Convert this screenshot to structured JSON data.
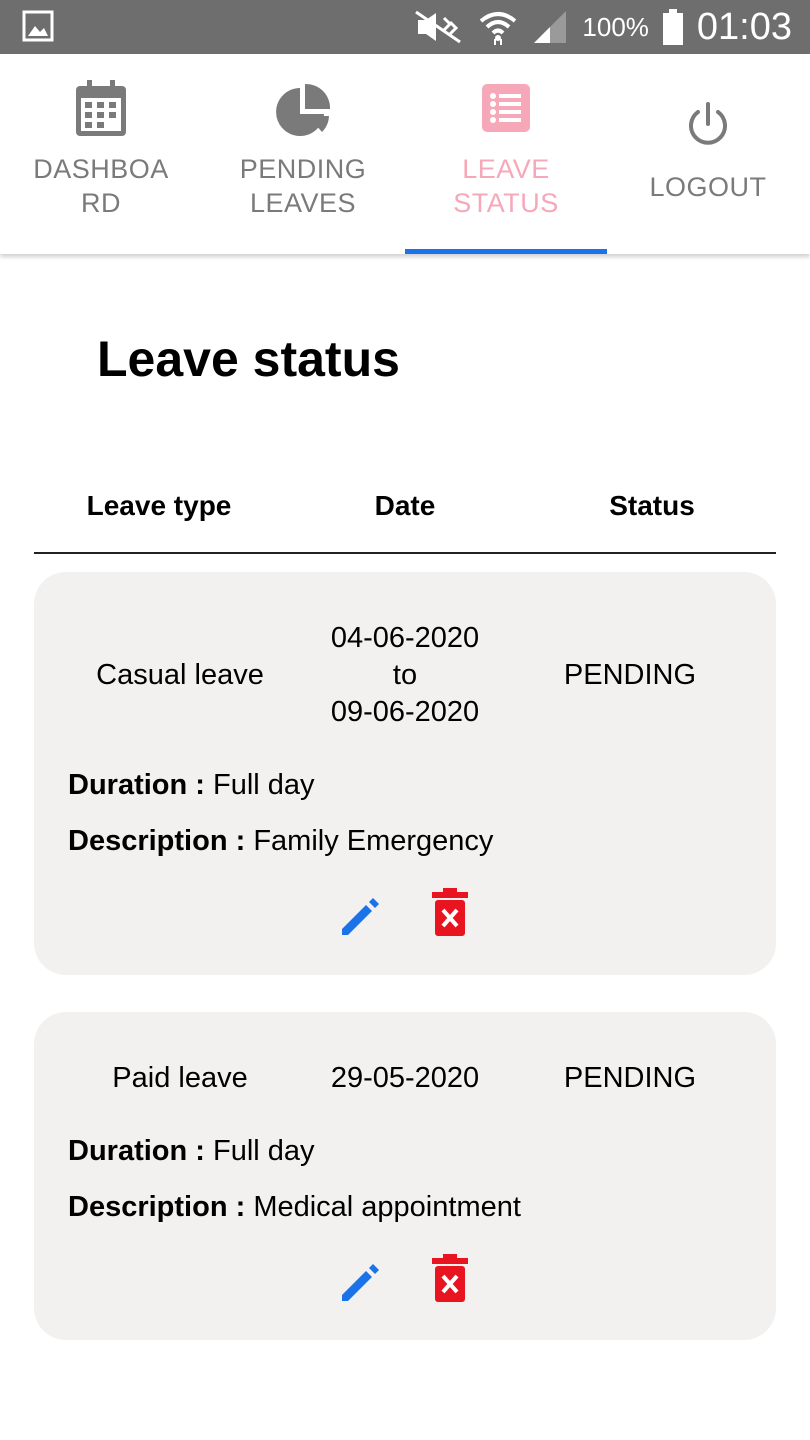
{
  "status_bar": {
    "battery": "100%",
    "time": "01:03"
  },
  "tabs": [
    {
      "label": "DASHBOA\nRD",
      "icon": "calendar-icon"
    },
    {
      "label": "PENDING\nLEAVES",
      "icon": "pie-chart-icon"
    },
    {
      "label": "LEAVE\nSTATUS",
      "icon": "list-icon",
      "active": true
    },
    {
      "label": "LOGOUT",
      "icon": "power-icon"
    }
  ],
  "page_title": "Leave status",
  "table_header": {
    "type": "Leave type",
    "date": "Date",
    "status": "Status"
  },
  "leaves": [
    {
      "type": "Casual leave",
      "date_from": "04-06-2020",
      "date_sep": "to",
      "date_to": "09-06-2020",
      "status": "PENDING",
      "duration_label": "Duration :",
      "duration": "Full day",
      "description_label": "Description :",
      "description": "Family Emergency"
    },
    {
      "type": "Paid leave",
      "date": "29-05-2020",
      "status": "PENDING",
      "duration_label": "Duration :",
      "duration": "Full day",
      "description_label": "Description :",
      "description": "Medical appointment"
    }
  ],
  "colors": {
    "active_tab": "#f7a8b8",
    "indicator": "#1a73e8",
    "edit": "#1a73e8",
    "delete": "#e8141f"
  }
}
